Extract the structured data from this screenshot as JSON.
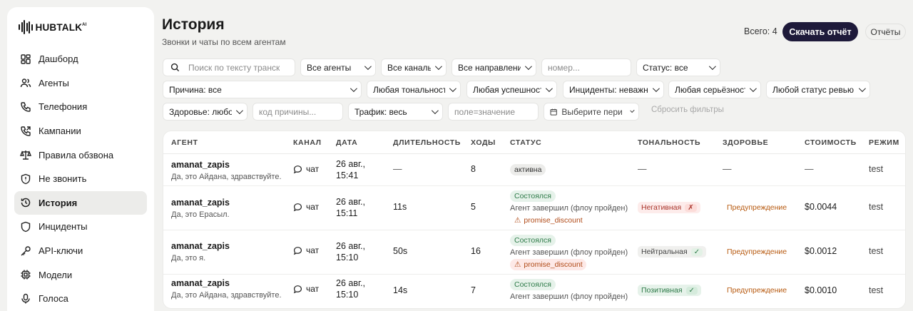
{
  "brand": {
    "name": "HUBTALK",
    "sup": "AI"
  },
  "sidebar": {
    "items": [
      {
        "label": "Дашборд",
        "icon": "dashboard-icon",
        "active": false
      },
      {
        "label": "Агенты",
        "icon": "users-icon",
        "active": false
      },
      {
        "label": "Телефония",
        "icon": "phone-icon",
        "active": false
      },
      {
        "label": "Кампании",
        "icon": "phone-outgoing-icon",
        "active": false
      },
      {
        "label": "Правила обзвона",
        "icon": "scales-icon",
        "active": false
      },
      {
        "label": "Не звонить",
        "icon": "shield-icon",
        "active": false
      },
      {
        "label": "История",
        "icon": "history-icon",
        "active": true
      },
      {
        "label": "Инциденты",
        "icon": "incident-icon",
        "active": false
      },
      {
        "label": "API-ключи",
        "icon": "key-icon",
        "active": false
      },
      {
        "label": "Модели",
        "icon": "chip-icon",
        "active": false
      },
      {
        "label": "Голоса",
        "icon": "mic-icon",
        "active": false
      }
    ]
  },
  "header": {
    "title": "История",
    "subtitle": "Звонки и чаты по всем агентам",
    "total": "Всего: 4",
    "download_label": "Скачать отчёт",
    "reports_label": "Отчёты"
  },
  "filters": {
    "search_placeholder": "Поиск по тексту транск",
    "agents": "Все агенты",
    "channels": "Все каналы",
    "directions": "Все направления",
    "number_placeholder": "номер...",
    "status": "Статус: все",
    "reason": "Причина: все",
    "tonality": "Любая тональность",
    "success": "Любая успешность",
    "incidents": "Инциденты: неважно",
    "severity": "Любая серьёзность",
    "review": "Любой статус ревью",
    "health": "Здоровье: любое",
    "reason_code_placeholder": "код причины...",
    "traffic": "Трафик: весь",
    "kv_placeholder": "поле=значение",
    "period": "Выберите период",
    "reset": "Сбросить фильтры"
  },
  "table": {
    "columns": {
      "agent": "АГЕНТ",
      "channel": "КАНАЛ",
      "date": "ДАТА",
      "duration": "ДЛИТЕЛЬНОСТЬ",
      "turns": "ХОДЫ",
      "status": "СТАТУС",
      "tonality": "ТОНАЛЬНОСТЬ",
      "health": "ЗДОРОВЬЕ",
      "cost": "СТОИМОСТЬ",
      "mode": "РЕЖИМ"
    },
    "rows": [
      {
        "agent": "amanat_zapis",
        "snippet": "Да, это Айдана, здравствуйте.",
        "channel": "чат",
        "date1": "26 авг.,",
        "date2": "15:41",
        "duration": "—",
        "turns": "8",
        "status": "активна",
        "status_note": "",
        "warning": "",
        "tonality": "—",
        "tonality_mark": "",
        "health": "—",
        "cost": "—",
        "mode": "test"
      },
      {
        "agent": "amanat_zapis",
        "snippet": "Да, это Ерасыл.",
        "channel": "чат",
        "date1": "26 авг.,",
        "date2": "15:11",
        "duration": "11s",
        "turns": "5",
        "status": "Состоялся",
        "status_note": "Агент завершил (флоу пройден)",
        "warning": "promise_discount",
        "tonality": "Негативная",
        "tonality_mark": "✗",
        "health": "Предупреждение",
        "cost": "$0.0044",
        "mode": "test"
      },
      {
        "agent": "amanat_zapis",
        "snippet": "Да, это я.",
        "channel": "чат",
        "date1": "26 авг.,",
        "date2": "15:10",
        "duration": "50s",
        "turns": "16",
        "status": "Состоялся",
        "status_note": "Агент завершил (флоу пройден)",
        "warning": "promise_discount",
        "tonality": "Нейтральная",
        "tonality_mark": "✓",
        "health": "Предупреждение",
        "cost": "$0.0012",
        "mode": "test"
      },
      {
        "agent": "amanat_zapis",
        "snippet": "Да, это Айдана, здравствуйте.",
        "channel": "чат",
        "date1": "26 авг.,",
        "date2": "15:10",
        "duration": "14s",
        "turns": "7",
        "status": "Состоялся",
        "status_note": "Агент завершил (флоу пройден)",
        "warning": "",
        "tonality": "Позитивная",
        "tonality_mark": "✓",
        "health": "Предупреждение",
        "cost": "$0.0010",
        "mode": "test"
      }
    ]
  },
  "colors": {
    "primary_button": "#1e1a3a",
    "warning_text": "#b04a17",
    "success_green": "#2d7a48",
    "negative_red": "#a9352b"
  }
}
